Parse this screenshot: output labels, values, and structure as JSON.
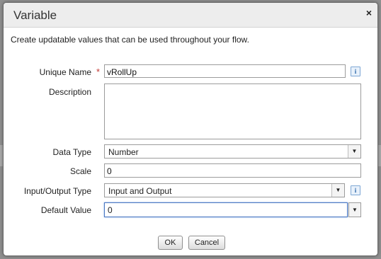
{
  "dialog": {
    "title": "Variable",
    "close_glyph": "×",
    "intro": "Create updatable values that can be used throughout your flow."
  },
  "form": {
    "unique_name_label": "Unique Name",
    "required_marker": "*",
    "unique_name_value": "vRollUp",
    "description_label": "Description",
    "description_value": "",
    "data_type_label": "Data Type",
    "data_type_value": "Number",
    "scale_label": "Scale",
    "scale_value": "0",
    "io_type_label": "Input/Output Type",
    "io_type_value": "Input and Output",
    "default_value_label": "Default Value",
    "default_value_value": "0",
    "info_glyph": "i",
    "dropdown_glyph": "▼"
  },
  "buttons": {
    "ok": "OK",
    "cancel": "Cancel"
  }
}
